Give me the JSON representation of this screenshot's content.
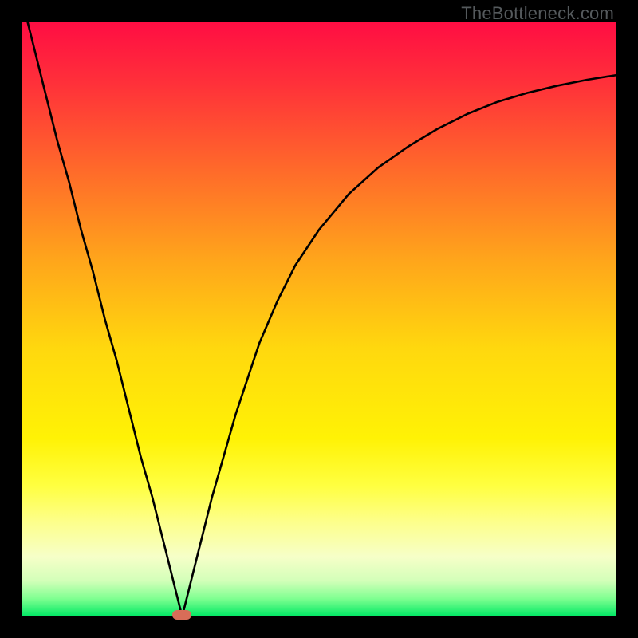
{
  "watermark": "TheBottleneck.com",
  "chart_data": {
    "type": "line",
    "title": "",
    "xlabel": "",
    "ylabel": "",
    "x_range": [
      0,
      100
    ],
    "y_range": [
      0,
      100
    ],
    "series": [
      {
        "name": "curve",
        "x": [
          0,
          2,
          4,
          6,
          8,
          10,
          12,
          14,
          16,
          18,
          20,
          22,
          24,
          26,
          27,
          28,
          30,
          32,
          34,
          36,
          38,
          40,
          43,
          46,
          50,
          55,
          60,
          65,
          70,
          75,
          80,
          85,
          90,
          95,
          100
        ],
        "y": [
          104,
          96,
          88,
          80,
          73,
          65,
          58,
          50,
          43,
          35,
          27,
          20,
          12,
          4,
          0,
          4,
          12,
          20,
          27,
          34,
          40,
          46,
          53,
          59,
          65,
          71,
          75.5,
          79,
          82,
          84.5,
          86.5,
          88,
          89.2,
          90.2,
          91
        ]
      }
    ],
    "marker": {
      "x_pct": 27,
      "color": "#d86d58"
    },
    "gradient_stops": [
      {
        "pct": 0,
        "color": "#ff0d43"
      },
      {
        "pct": 10,
        "color": "#ff2f3a"
      },
      {
        "pct": 25,
        "color": "#ff6a2a"
      },
      {
        "pct": 40,
        "color": "#ffa51b"
      },
      {
        "pct": 55,
        "color": "#ffd80e"
      },
      {
        "pct": 70,
        "color": "#fff205"
      },
      {
        "pct": 78,
        "color": "#ffff40"
      },
      {
        "pct": 84,
        "color": "#fdff8a"
      },
      {
        "pct": 90,
        "color": "#f6ffc8"
      },
      {
        "pct": 94,
        "color": "#d3ffb9"
      },
      {
        "pct": 97,
        "color": "#7fff91"
      },
      {
        "pct": 100,
        "color": "#00e864"
      }
    ]
  }
}
